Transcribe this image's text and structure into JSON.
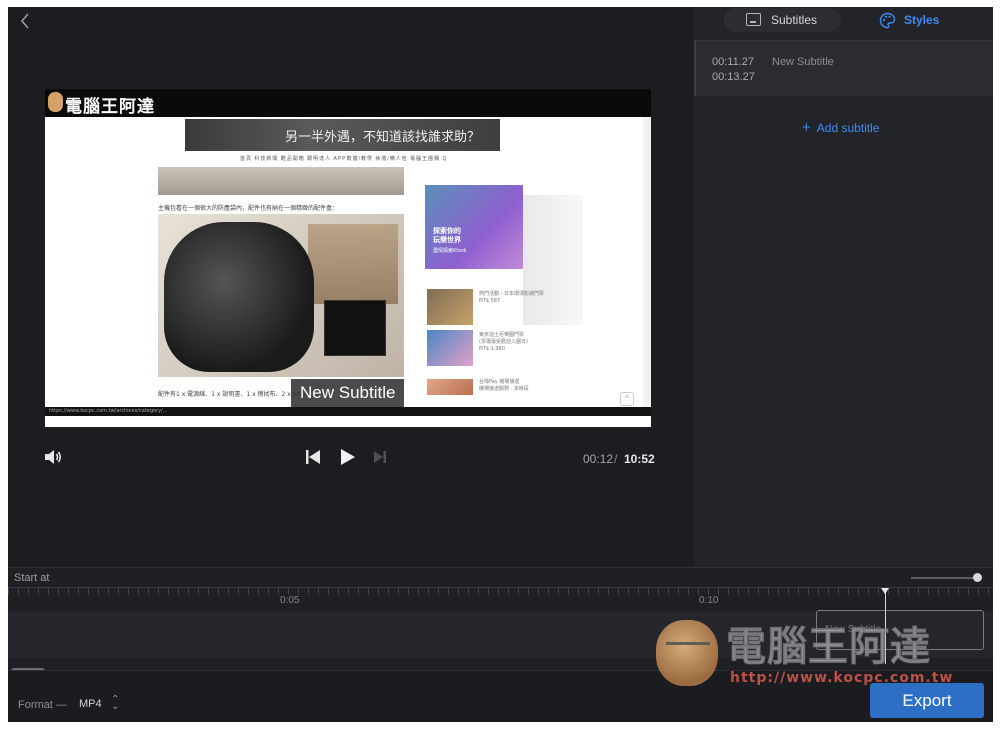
{
  "player": {
    "back_label": "‹",
    "video": {
      "logo_text": "電腦王阿達",
      "banner_text": "另一半外遇，不知道該找誰求助？",
      "nav_text": "首頁  科技新聞  酷品開箱  聰明達人  APP軟體/教學  休閒/懶人包  電腦王團購  Q",
      "intro_text": "主機包看在一個很大的防塵袋內，配件也有納在一個精緻的配件盒：",
      "footer_text": "配件有1 x 電源線、1 x 說明書、1 x 擦拭布、2 x SATA",
      "ad_title": "探索你的\n玩樂世界",
      "ad_sub": "盡情探索Klook",
      "thumb1_text": "熱門活動・日本環球影城門票\nNT$ 587",
      "thumb2_text": "東京迪士尼樂園門票\n(票選最受歡迎入園日)\nNT$ 1,980",
      "thumb3_text": "台灣Pay 機場接送\n機場接送服務 · 多時段",
      "status_url": "https://www.kocpc.com.tw/archives/category/...",
      "subtitle_overlay": "New Subtitle"
    },
    "controls": {
      "current_time": "00:12",
      "separator": "/",
      "total_time": "10:52"
    }
  },
  "side": {
    "tabs": {
      "subtitles_label": "Subtitles",
      "styles_label": "Styles"
    },
    "subtitle_items": [
      {
        "start": "00:11.27",
        "end": "00:13.27",
        "text": "New Subtitle"
      }
    ],
    "add_label": "Add subtitle"
  },
  "timeline": {
    "start_at_label": "Start at",
    "tick_labels": [
      "0:05",
      "0:10"
    ],
    "clip_label": "New Subtitle"
  },
  "bottom": {
    "format_label": "Format —",
    "format_value": "MP4",
    "export_label": "Export"
  },
  "watermark": {
    "title": "電腦王阿達",
    "url": "http://www.kocpc.com.tw"
  },
  "colors": {
    "accent": "#3b8cf2",
    "export_bg": "#2d6fc4",
    "panel_bg": "#232429",
    "app_bg": "#1b1c20"
  }
}
